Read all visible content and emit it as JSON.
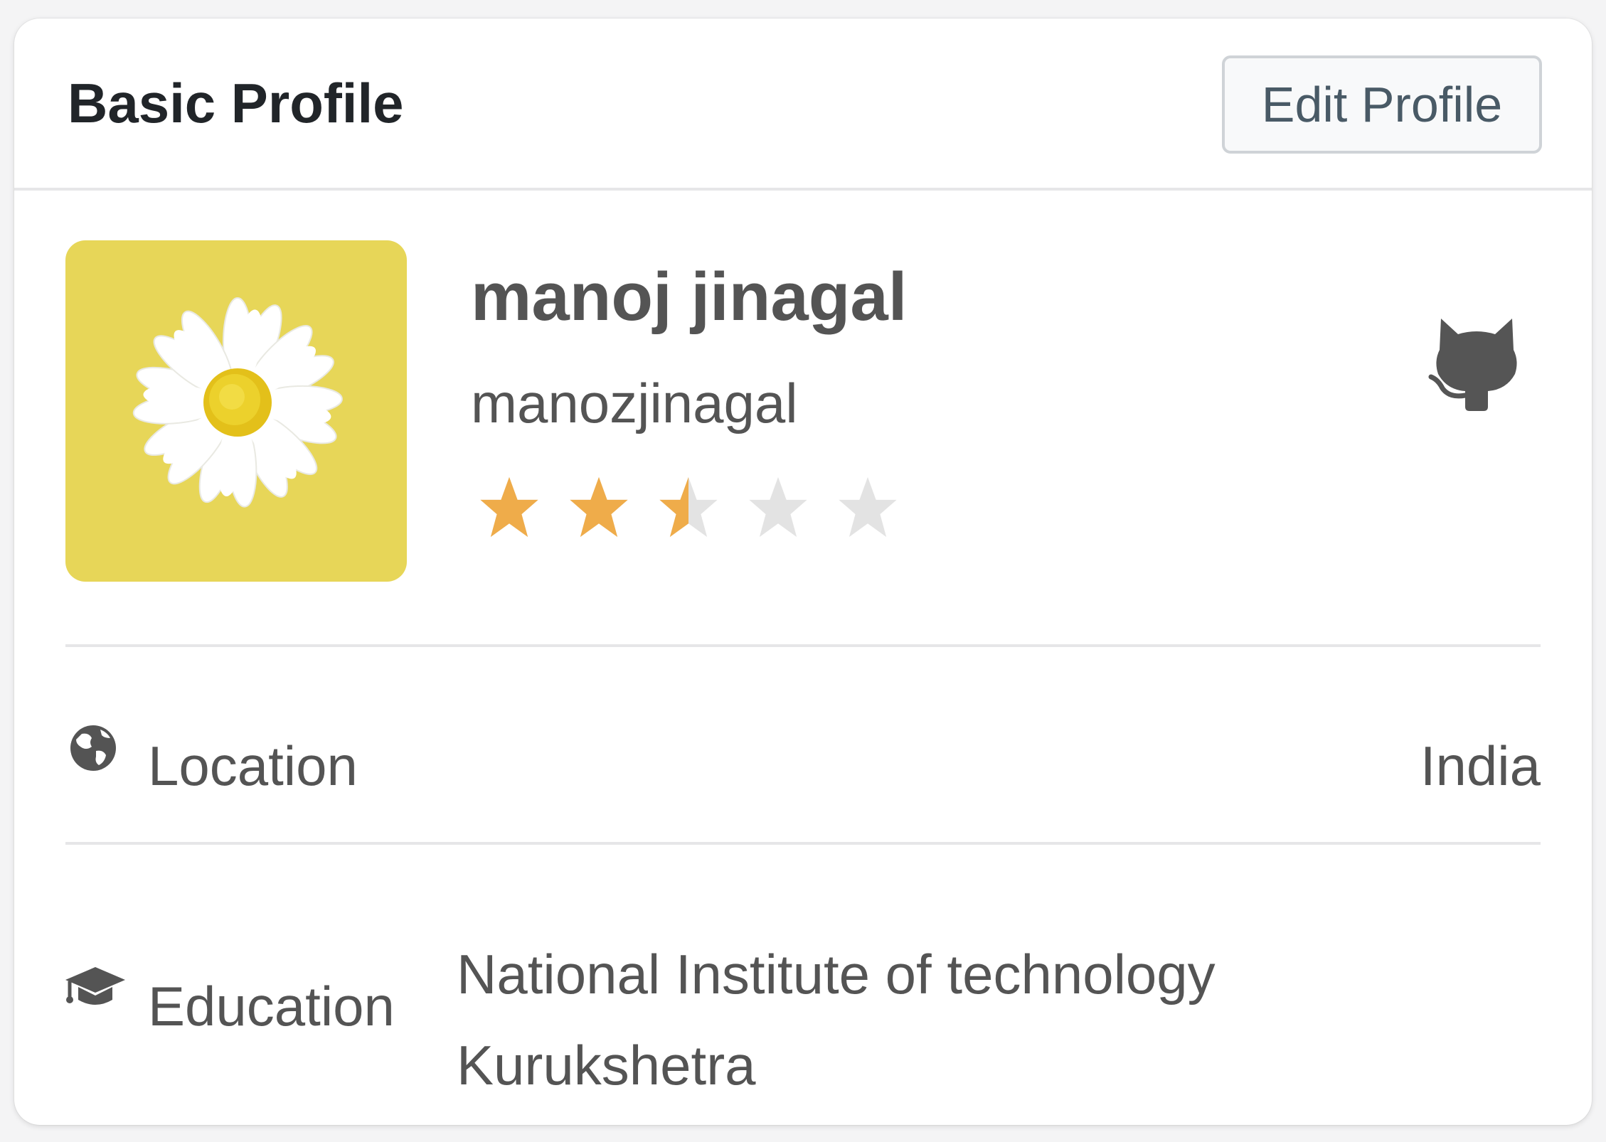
{
  "card": {
    "title": "Basic Profile",
    "edit_button_label": "Edit Profile"
  },
  "profile": {
    "display_name": "manoj jinagal",
    "username": "manozjinagal",
    "rating": 2.5,
    "rating_max": 5,
    "star_filled_color": "#efac4a",
    "star_empty_color": "#e3e3e3",
    "avatar_background": "#e7d658",
    "avatar_icon": "daisy-image",
    "social_icon": "github-icon"
  },
  "details": {
    "location": {
      "icon": "globe-icon",
      "label": "Location",
      "value": "India"
    },
    "education": {
      "icon": "graduation-cap-icon",
      "label": "Education",
      "value": "National Institute of technology Kurukshetra"
    }
  }
}
